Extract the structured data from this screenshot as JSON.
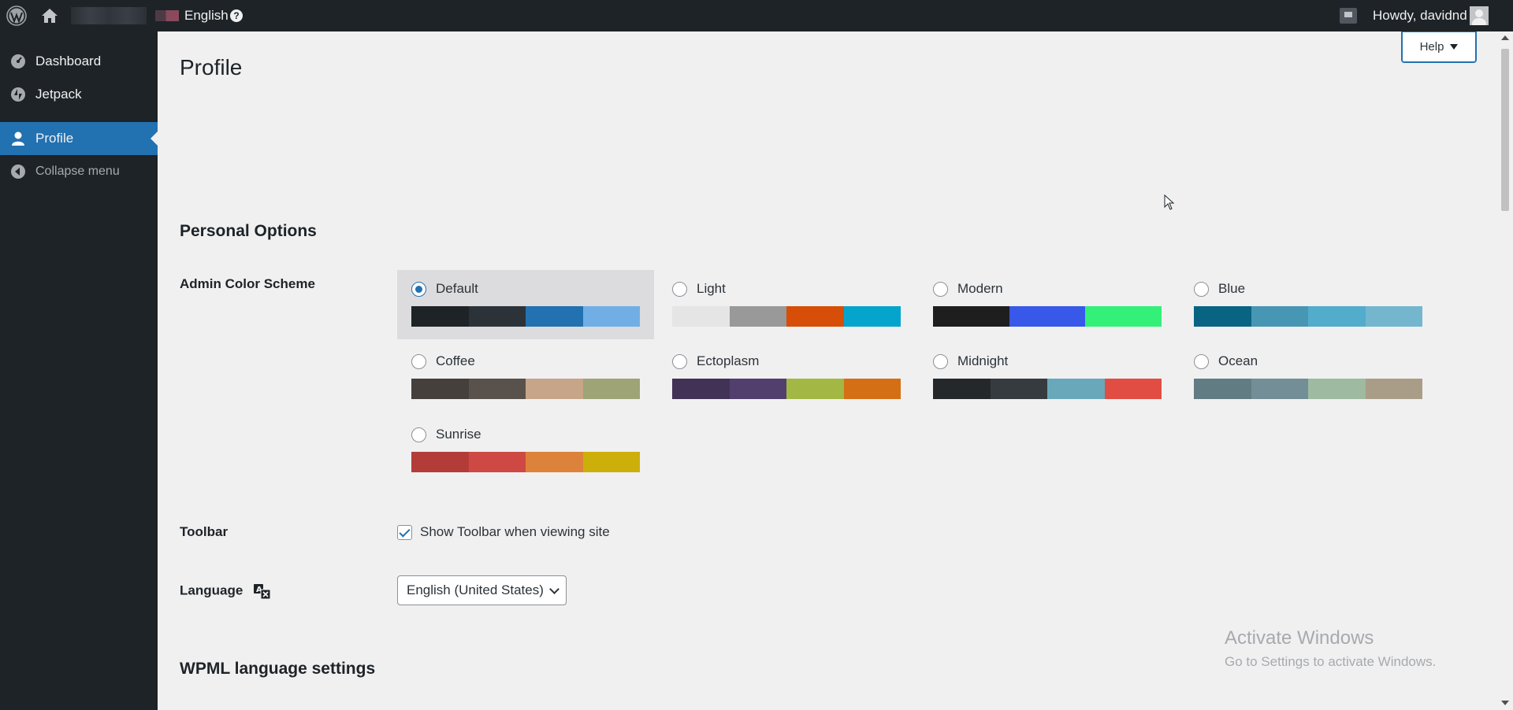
{
  "adminbar": {
    "language_label": "English",
    "language_help_icon": "question-circle-icon",
    "howdy_text": "Howdy, davidnd"
  },
  "sidebar": {
    "items": [
      {
        "label": "Dashboard",
        "icon": "dashboard-icon"
      },
      {
        "label": "Jetpack",
        "icon": "jetpack-icon"
      },
      {
        "label": "Profile",
        "icon": "user-icon",
        "current": true
      },
      {
        "label": "Collapse menu",
        "icon": "collapse-icon"
      }
    ]
  },
  "header": {
    "title": "Profile",
    "help_label": "Help"
  },
  "personal_options": {
    "section_title": "Personal Options",
    "color_scheme_label": "Admin Color Scheme",
    "schemes": [
      {
        "name": "Default",
        "checked": true,
        "colors": [
          "#1d2327",
          "#2c3338",
          "#2271b1",
          "#72aee6"
        ]
      },
      {
        "name": "Light",
        "checked": false,
        "colors": [
          "#e5e5e5",
          "#999999",
          "#d64e07",
          "#04a4cc"
        ]
      },
      {
        "name": "Modern",
        "checked": false,
        "colors": [
          "#1e1e1e",
          "#3858e9",
          "#33f078"
        ]
      },
      {
        "name": "Blue",
        "checked": false,
        "colors": [
          "#096484",
          "#4796b3",
          "#52accc",
          "#74b6ce"
        ]
      },
      {
        "name": "Coffee",
        "checked": false,
        "colors": [
          "#46403c",
          "#59524c",
          "#c7a589",
          "#9ea476"
        ]
      },
      {
        "name": "Ectoplasm",
        "checked": false,
        "colors": [
          "#413256",
          "#523f6d",
          "#a3b745",
          "#d46f15"
        ]
      },
      {
        "name": "Midnight",
        "checked": false,
        "colors": [
          "#25282b",
          "#363b3f",
          "#69a8bb",
          "#e14d43"
        ]
      },
      {
        "name": "Ocean",
        "checked": false,
        "colors": [
          "#627c83",
          "#738e96",
          "#9ebaa0",
          "#aa9d88"
        ]
      },
      {
        "name": "Sunrise",
        "checked": false,
        "colors": [
          "#b43c38",
          "#cf4944",
          "#dd823b",
          "#ccaf0b"
        ]
      }
    ],
    "toolbar_label": "Toolbar",
    "toolbar_checkbox_label": "Show Toolbar when viewing site",
    "toolbar_checked": true,
    "language_label": "Language",
    "language_value": "English (United States)"
  },
  "wpml": {
    "section_title": "WPML language settings"
  },
  "watermark": {
    "line1": "Activate Windows",
    "line2": "Go to Settings to activate Windows."
  },
  "colors": {
    "admin_bar": "#1d2327",
    "accent": "#2271b1",
    "background": "#f0f0f1"
  }
}
